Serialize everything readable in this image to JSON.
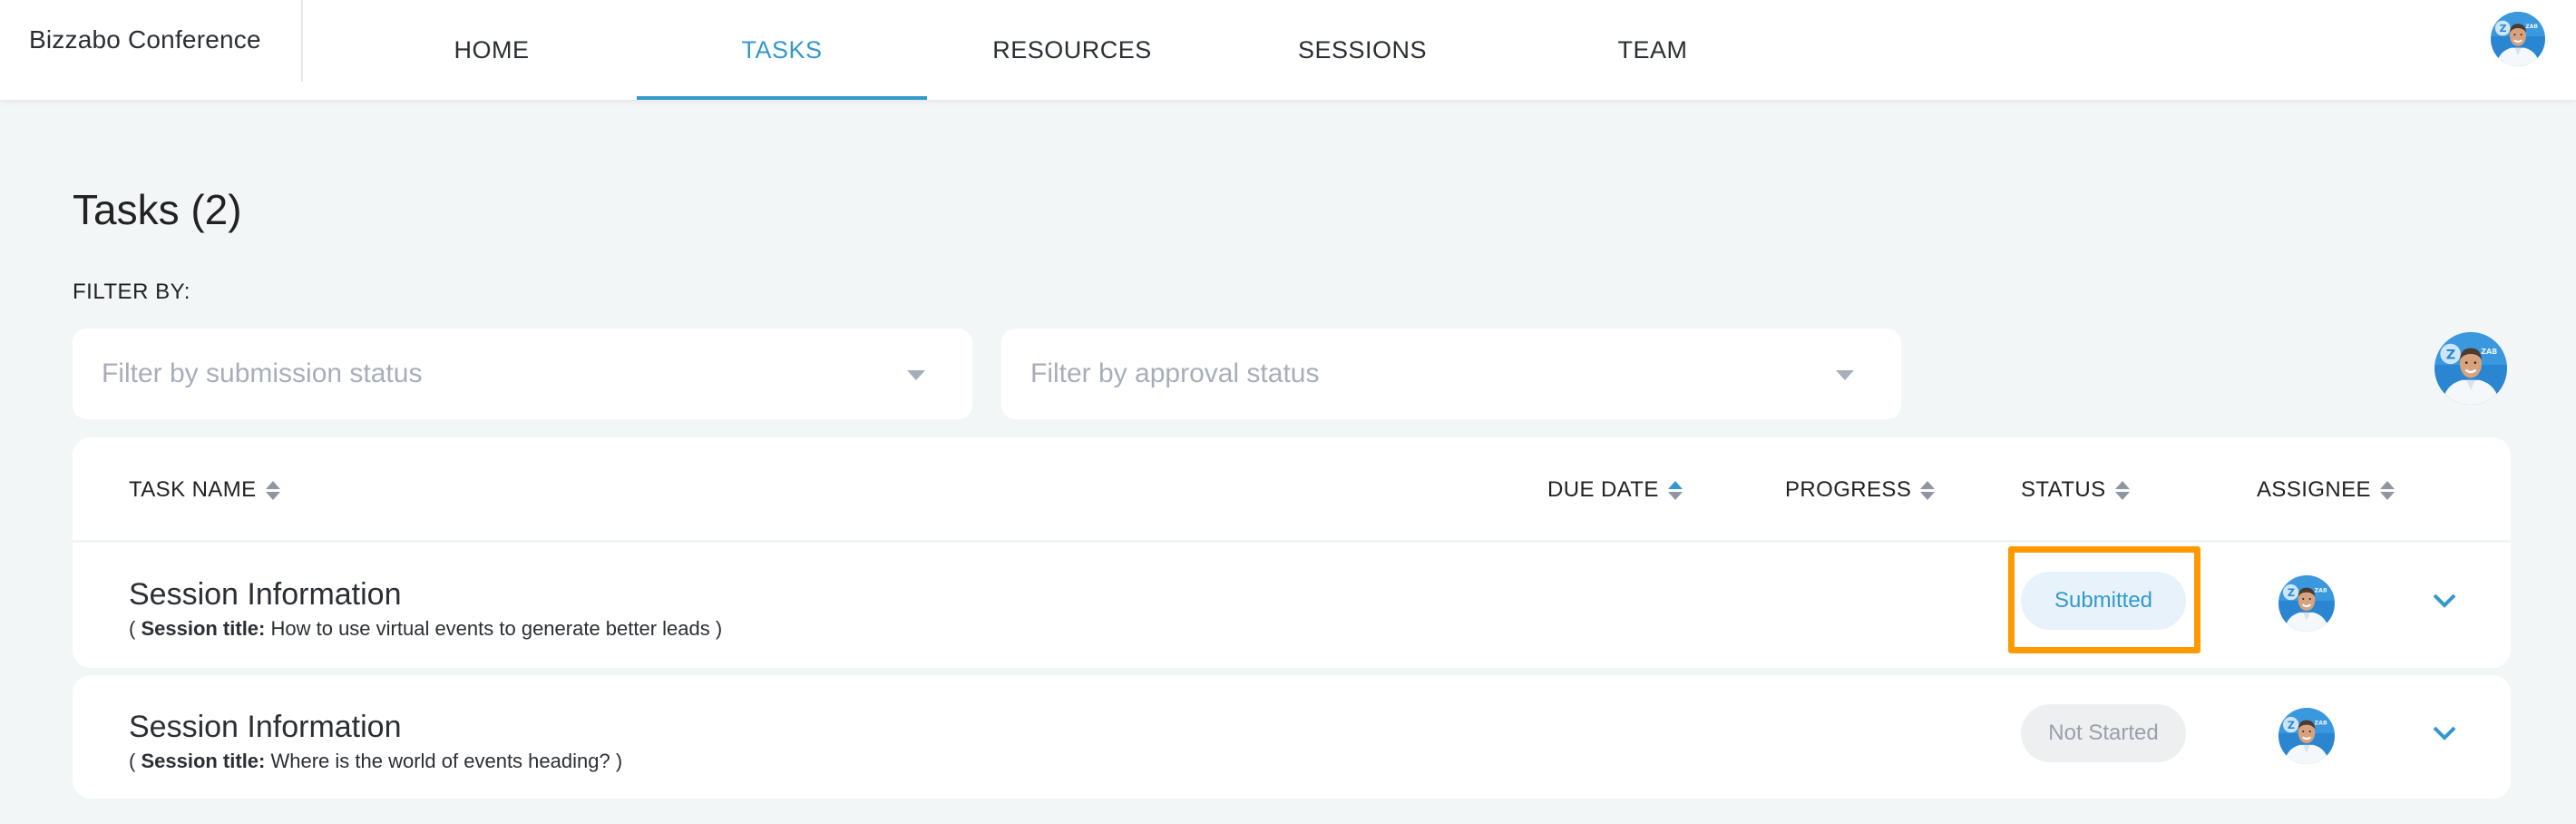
{
  "app": {
    "brand": "Bizzabo Conference",
    "accent_color": "#3399cc",
    "highlight_color": "#ff9900"
  },
  "nav": {
    "tabs": [
      {
        "label": "HOME",
        "active": false
      },
      {
        "label": "TASKS",
        "active": true
      },
      {
        "label": "RESOURCES",
        "active": false
      },
      {
        "label": "SESSIONS",
        "active": false
      },
      {
        "label": "TEAM",
        "active": false
      }
    ],
    "user_avatar": "user-avatar-photo"
  },
  "page": {
    "title": "Tasks (2)",
    "filter_label": "FILTER BY:",
    "filters": [
      {
        "placeholder": "Filter by submission status",
        "value": ""
      },
      {
        "placeholder": "Filter by approval status",
        "value": ""
      }
    ]
  },
  "table": {
    "columns": [
      {
        "label": "TASK NAME",
        "sort": "none"
      },
      {
        "label": "DUE DATE",
        "sort": "ascending"
      },
      {
        "label": "PROGRESS",
        "sort": "none"
      },
      {
        "label": "STATUS",
        "sort": "none"
      },
      {
        "label": "ASSIGNEE",
        "sort": "none"
      }
    ],
    "rows": [
      {
        "name": "Session Information",
        "sub_prefix": "( ",
        "sub_label": "Session title:",
        "sub_value": " How to use virtual events to generate better leads )",
        "due_date": "",
        "progress": "",
        "status": "Submitted",
        "status_color": "#3399cc",
        "highlighted": true
      },
      {
        "name": "Session Information",
        "sub_prefix": "( ",
        "sub_label": "Session title:",
        "sub_value": " Where is the world of events heading? )",
        "due_date": "",
        "progress": "",
        "status": "Not Started",
        "status_color": "#9aa0aa",
        "highlighted": false
      }
    ]
  }
}
